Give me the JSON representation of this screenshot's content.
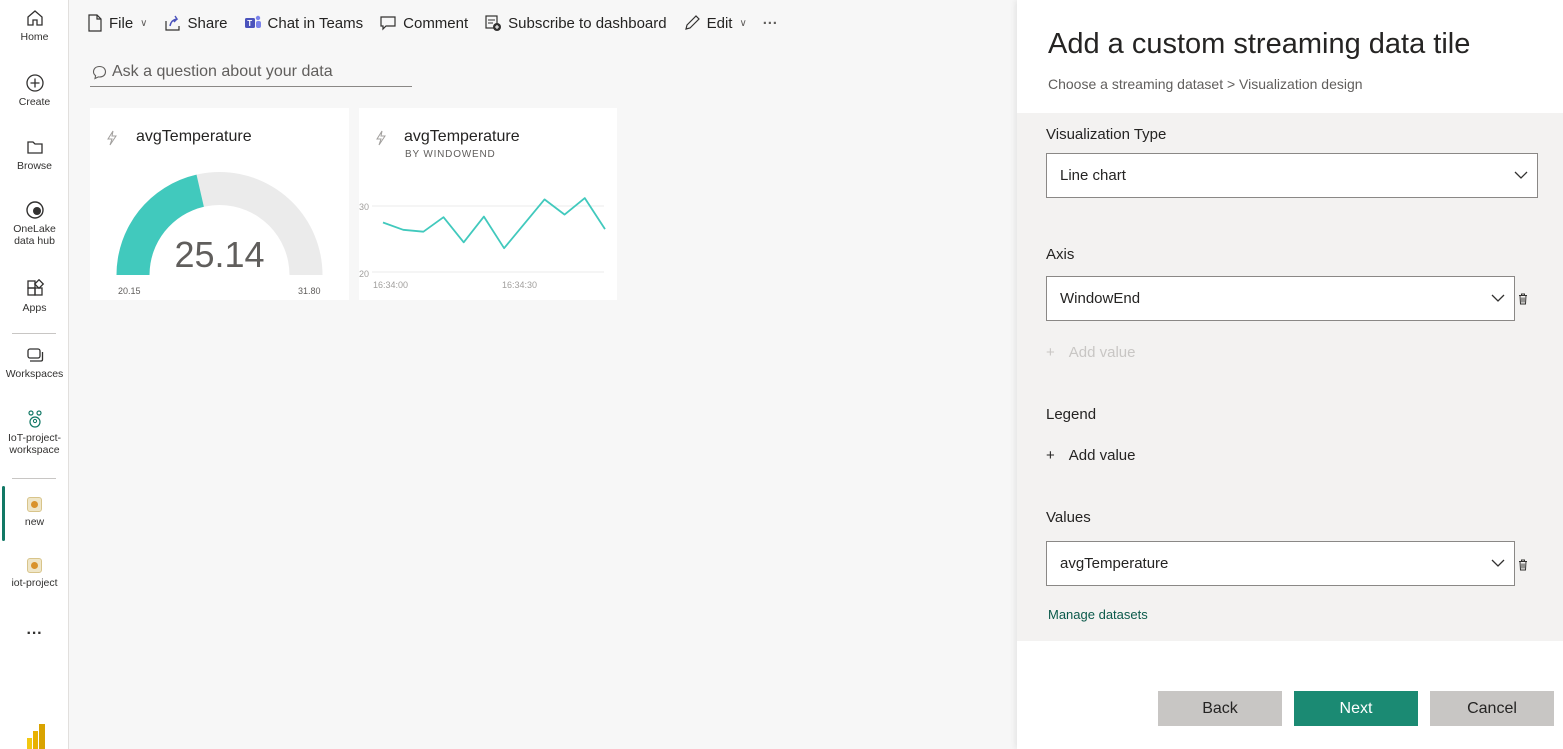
{
  "nav": {
    "home": "Home",
    "create": "Create",
    "browse": "Browse",
    "onelake_1": "OneLake",
    "onelake_2": "data hub",
    "apps": "Apps",
    "workspaces": "Workspaces",
    "workspace_1": "IoT-project-",
    "workspace_2": "workspace",
    "item_new": "new",
    "item_iot": "iot-project",
    "more": "···"
  },
  "toolbar": {
    "file": "File",
    "share": "Share",
    "chat": "Chat in Teams",
    "comment": "Comment",
    "subscribe": "Subscribe to dashboard",
    "edit": "Edit",
    "more": "···"
  },
  "qna": {
    "placeholder": "Ask a question about your data"
  },
  "gauge_tile": {
    "title": "avgTemperature",
    "value": "25.14",
    "min_label": "20.15",
    "max_label": "31.80",
    "gauge": {
      "min": 20.15,
      "max": 31.8,
      "value": 25.14
    },
    "accent": "#41c9bd"
  },
  "line_tile": {
    "title": "avgTemperature",
    "subtitle": "BY WINDOWEND",
    "y_tick_top": "30",
    "y_tick_bottom": "20",
    "x_tick_1": "16:34:00",
    "x_tick_2": "16:34:30",
    "accent": "#41c9bd"
  },
  "chart_data": {
    "type": "line",
    "xlabel": "",
    "ylabel": "",
    "ylim": [
      20,
      33
    ],
    "x_ticks": [
      "16:34:00",
      "16:34:30"
    ],
    "y_ticks": [
      20,
      30
    ],
    "series": [
      {
        "values": [
          27.5,
          26.4,
          26.1,
          28.3,
          24.5,
          28.4,
          23.6,
          27.3,
          31.0,
          28.7,
          31.2,
          26.5
        ]
      }
    ],
    "grid": true,
    "legend": "none"
  },
  "pane": {
    "title": "Add a custom streaming data tile",
    "breadcrumb": "Choose a streaming dataset > Visualization design",
    "viz_type_label": "Visualization Type",
    "viz_type_value": "Line chart",
    "axis_label": "Axis",
    "axis_value": "WindowEnd",
    "axis_add": "Add value",
    "legend_label": "Legend",
    "legend_add": "Add value",
    "values_label": "Values",
    "values_value": "avgTemperature",
    "manage": "Manage datasets",
    "back": "Back",
    "next": "Next",
    "cancel": "Cancel"
  }
}
